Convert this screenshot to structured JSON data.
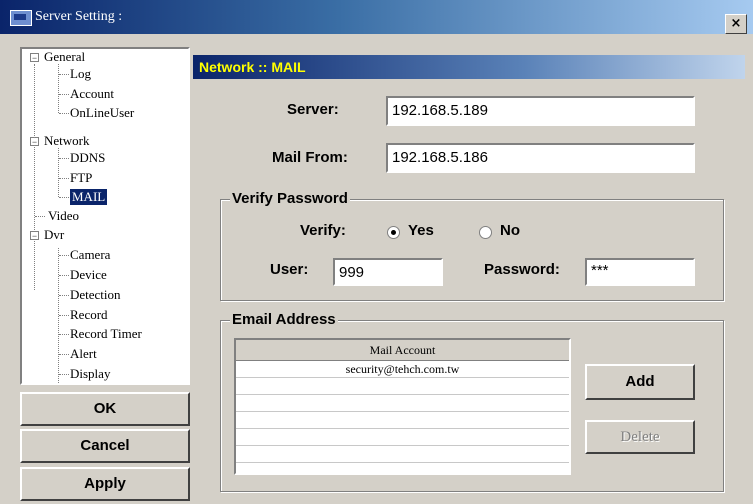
{
  "window": {
    "title": "Server Setting :",
    "close_label": "×"
  },
  "tree": {
    "items": [
      {
        "label": "General",
        "expander": "−"
      },
      {
        "label": "Log"
      },
      {
        "label": "Account"
      },
      {
        "label": "OnLineUser"
      },
      {
        "label": "Network",
        "expander": "−"
      },
      {
        "label": "DDNS"
      },
      {
        "label": "FTP"
      },
      {
        "label": "MAIL",
        "selected": true
      },
      {
        "label": "Video"
      },
      {
        "label": "Dvr",
        "expander": "−"
      },
      {
        "label": "Camera"
      },
      {
        "label": "Device"
      },
      {
        "label": "Detection"
      },
      {
        "label": "Record"
      },
      {
        "label": "Record Timer"
      },
      {
        "label": "Alert"
      },
      {
        "label": "Display"
      }
    ]
  },
  "buttons": {
    "ok": "OK",
    "cancel": "Cancel",
    "apply": "Apply"
  },
  "section": {
    "title": "Network :: MAIL"
  },
  "server": {
    "label": "Server:",
    "value": "192.168.5.189"
  },
  "mail_from": {
    "label": "Mail From:",
    "value": "192.168.5.186"
  },
  "verify_group": {
    "title": "Verify Password",
    "verify_label": "Verify:",
    "yes_label": "Yes",
    "no_label": "No",
    "selected": "Yes",
    "user_label": "User:",
    "user_value": "999",
    "password_label": "Password:",
    "password_value": "***"
  },
  "email_group": {
    "title": "Email Address",
    "column_header": "Mail Account",
    "rows": [
      "security@tehch.com.tw",
      "",
      "",
      "",
      "",
      "",
      ""
    ],
    "add_label": "Add",
    "delete_label": "Delete"
  },
  "colors": {
    "title_bar": "#0a246a",
    "section_header_text": "#ffff00",
    "face": "#d4d0c8",
    "selection": "#0a246a"
  }
}
